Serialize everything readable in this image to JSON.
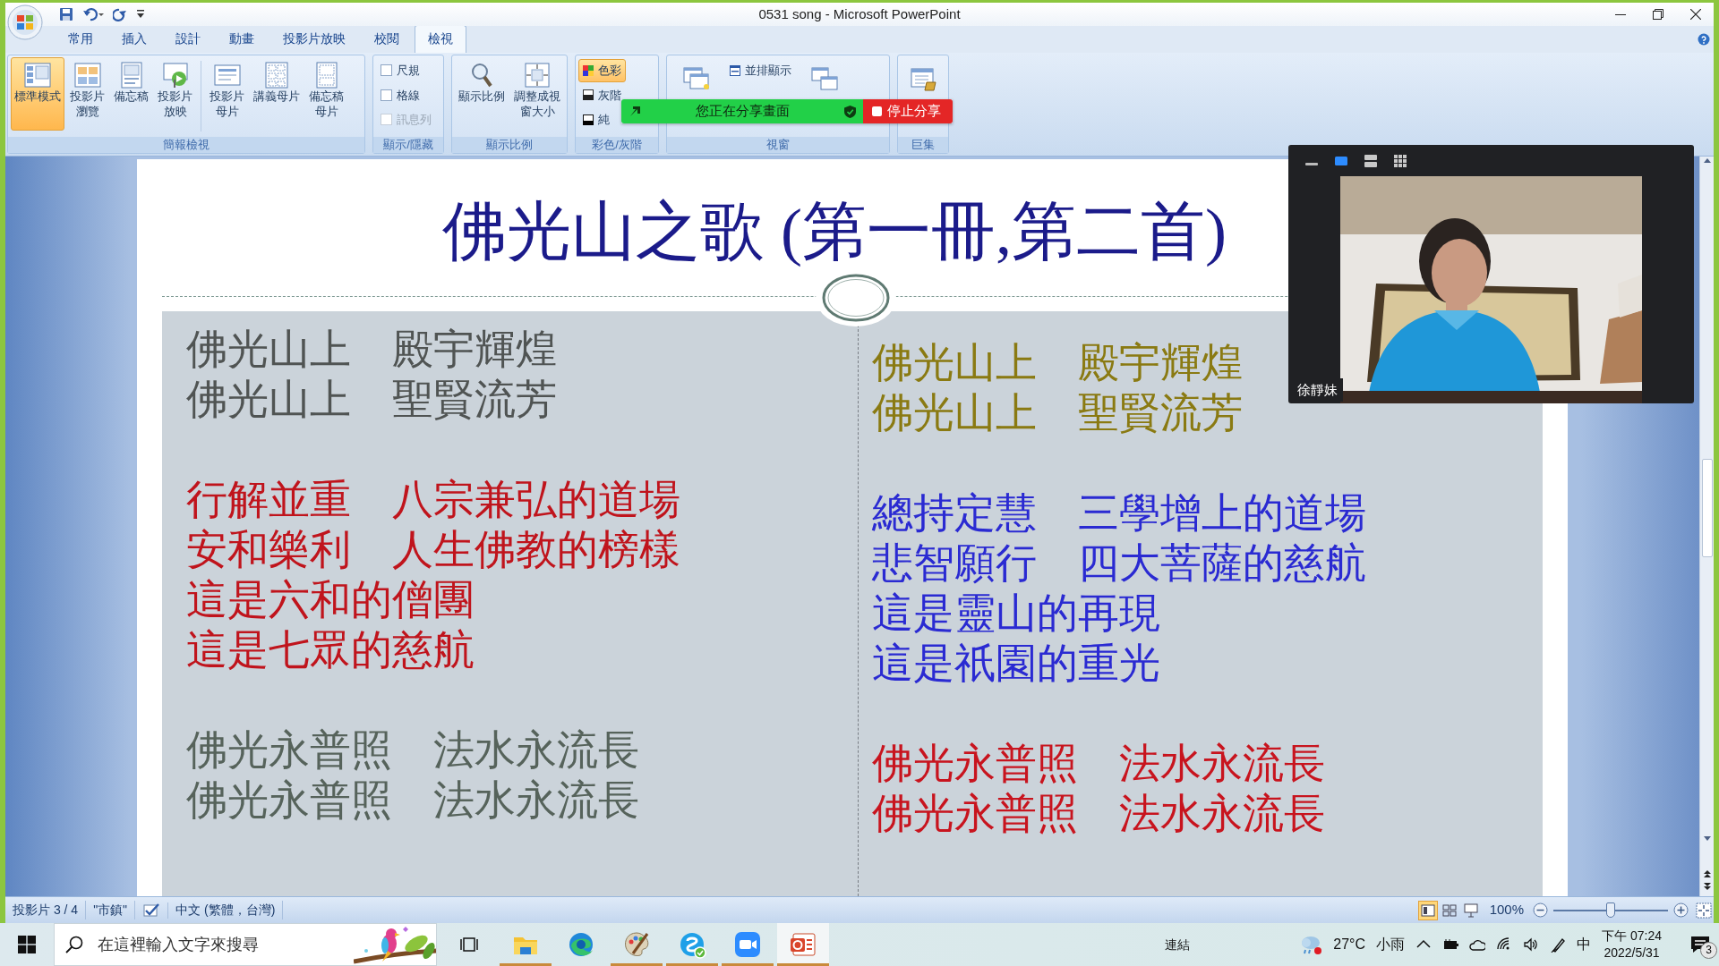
{
  "window": {
    "title": "0531 song - Microsoft PowerPoint"
  },
  "ribbon_tabs": [
    {
      "label": "常用",
      "selected": false
    },
    {
      "label": "插入",
      "selected": false
    },
    {
      "label": "設計",
      "selected": false
    },
    {
      "label": "動畫",
      "selected": false
    },
    {
      "label": "投影片放映",
      "selected": false
    },
    {
      "label": "校閱",
      "selected": false
    },
    {
      "label": "檢視",
      "selected": true
    }
  ],
  "ribbon_groups": [
    {
      "label": "簡報檢視",
      "items": [
        {
          "kind": "large",
          "label": "標準模式",
          "selected": true
        },
        {
          "kind": "large",
          "label": "投影片瀏覽",
          "selected": false
        },
        {
          "kind": "large",
          "label": "備忘稿",
          "selected": false
        },
        {
          "kind": "large",
          "label": "投影片放映",
          "selected": false
        },
        {
          "kind": "large",
          "label": "投影片母片",
          "selected": false
        },
        {
          "kind": "large",
          "label": "講義母片",
          "selected": false
        },
        {
          "kind": "large",
          "label": "備忘稿母片",
          "selected": false
        }
      ]
    },
    {
      "label": "顯示/隱藏",
      "items": [
        {
          "kind": "checkbox",
          "label": "尺規",
          "checked": false,
          "disabled": false
        },
        {
          "kind": "checkbox",
          "label": "格線",
          "checked": false,
          "disabled": false
        },
        {
          "kind": "checkbox",
          "label": "訊息列",
          "checked": false,
          "disabled": true
        }
      ]
    },
    {
      "label": "顯示比例",
      "items": [
        {
          "kind": "large",
          "label": "顯示比例"
        },
        {
          "kind": "large",
          "label": "調整成視窗大小"
        }
      ]
    },
    {
      "label": "彩色/灰階",
      "items": [
        {
          "kind": "small",
          "label": "色彩",
          "selected": true
        },
        {
          "kind": "small",
          "label": "灰階",
          "selected": false
        },
        {
          "kind": "small",
          "label": "純",
          "selected": false
        }
      ]
    },
    {
      "label": "視窗",
      "items": [
        {
          "kind": "large_icon"
        },
        {
          "kind": "small",
          "label": "並排顯示"
        },
        {
          "kind": "large_icon"
        }
      ]
    },
    {
      "label": "巨集",
      "items": [
        {
          "kind": "large_icon"
        }
      ]
    }
  ],
  "share_banner": {
    "message": "您正在分享畫面",
    "stop_button": "停止分享"
  },
  "slide": {
    "title": "佛光山之歌 (第一冊,第二首)",
    "columns": [
      {
        "stanzas": [
          {
            "color": "#505453",
            "lines": [
              "佛光山上　殿宇輝煌",
              "佛光山上　聖賢流芳"
            ]
          },
          {
            "color": "#c0141c",
            "lines": [
              "行解並重　八宗兼弘的道場",
              "安和樂利　人生佛教的榜樣",
              "這是六和的僧團",
              "這是七眾的慈航"
            ]
          },
          {
            "color": "#56635b",
            "lines": [
              "佛光永普照　法水永流長",
              "佛光永普照　法水永流長"
            ]
          }
        ]
      },
      {
        "stanzas": [
          {
            "color": "#8a7a12",
            "lines": [
              "佛光山上　殿宇輝煌",
              "佛光山上　聖賢流芳"
            ]
          },
          {
            "color": "#2a2ad2",
            "lines": [
              "總持定慧　三學增上的道場",
              "悲智願行　四大菩薩的慈航",
              "這是靈山的再現",
              "這是祇園的重光"
            ]
          },
          {
            "color": "#c8141e",
            "lines": [
              "佛光永普照　法水永流長",
              "佛光永普照　法水永流長"
            ]
          }
        ]
      }
    ]
  },
  "video_window": {
    "view_modes": [
      {
        "selected": true
      },
      {
        "selected": false
      },
      {
        "selected": false
      }
    ],
    "participant": "徐靜妹"
  },
  "status_bar": {
    "slide": "投影片 3 / 4",
    "theme": "\"市鎮\"",
    "language": "中文 (繁體，台灣)",
    "views": [
      {
        "selected": true
      },
      {
        "selected": false
      },
      {
        "selected": false
      }
    ],
    "zoom": "100%",
    "zoom_slider": {
      "level": 0.5
    }
  },
  "taskbar": {
    "search": {
      "placeholder": "在這裡輸入文字來搜尋"
    },
    "apps": [
      {
        "running": true,
        "active": false
      },
      {
        "running": false,
        "active": false
      },
      {
        "running": true,
        "active": false
      },
      {
        "running": true,
        "active": false
      },
      {
        "running": true,
        "active": false
      },
      {
        "running": true,
        "active": true
      }
    ],
    "links": "連結",
    "weather": {
      "temperature": "27°C",
      "condition": "小雨"
    },
    "ime": "中",
    "time": "下午 07:24",
    "date": "2022/5/31",
    "notifications": "3"
  }
}
